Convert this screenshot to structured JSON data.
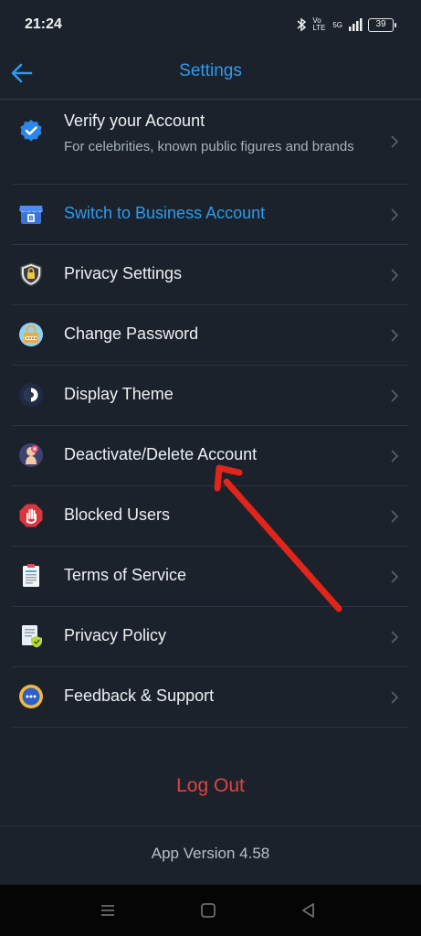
{
  "status": {
    "time": "21:24",
    "network": "Vo LTE",
    "signal": "5G",
    "battery": "39"
  },
  "header": {
    "title": "Settings"
  },
  "items": [
    {
      "label": "Verify your Account",
      "sub": "For celebrities, known public figures and brands",
      "icon": "verified-badge-icon"
    },
    {
      "label": "Switch to Business Account",
      "icon": "storefront-icon"
    },
    {
      "label": "Privacy Settings",
      "icon": "shield-lock-icon"
    },
    {
      "label": "Change Password",
      "icon": "password-lock-icon"
    },
    {
      "label": "Display Theme",
      "icon": "theme-icon"
    },
    {
      "label": "Deactivate/Delete Account",
      "icon": "delete-account-icon"
    },
    {
      "label": "Blocked Users",
      "icon": "stop-hand-icon"
    },
    {
      "label": "Terms of Service",
      "icon": "document-icon"
    },
    {
      "label": "Privacy Policy",
      "icon": "policy-document-icon"
    },
    {
      "label": "Feedback & Support",
      "icon": "chat-bubble-icon"
    }
  ],
  "logout_label": "Log Out",
  "version_label": "App Version 4.58",
  "colors": {
    "accent": "#2a9cf0",
    "danger": "#e0443f",
    "background": "#1b222c",
    "annotation_arrow": "#e1251b"
  }
}
